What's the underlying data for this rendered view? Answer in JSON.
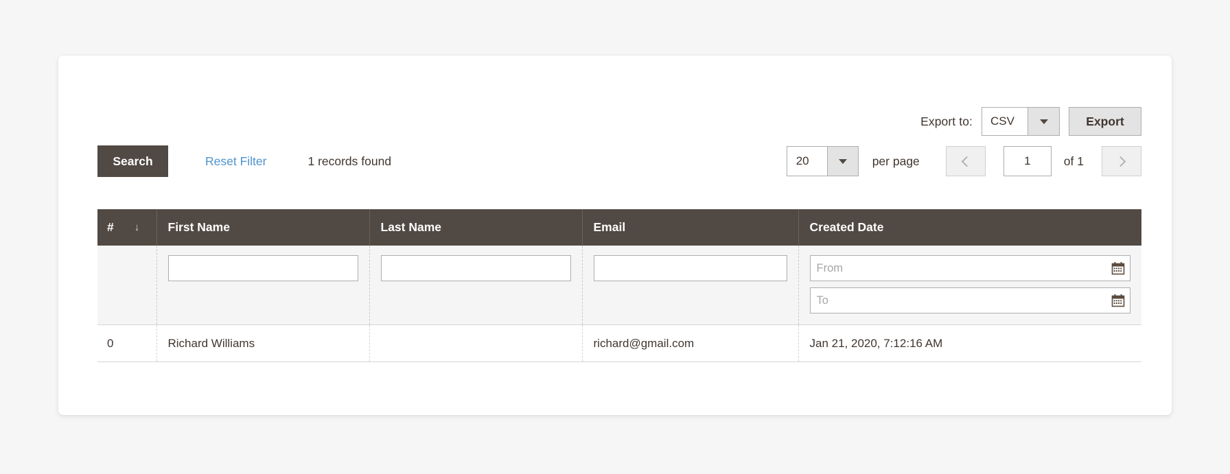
{
  "toolbar": {
    "export_to_label": "Export to:",
    "export_format": "CSV",
    "export_button_label": "Export"
  },
  "search_bar": {
    "search_button_label": "Search",
    "reset_filter_label": "Reset Filter",
    "records_found": "1 records found",
    "per_page_value": "20",
    "per_page_label": "per page",
    "current_page": "1",
    "of_pages": "of 1"
  },
  "table": {
    "columns": [
      {
        "label": "#",
        "sort_indicator": "↓"
      },
      {
        "label": "First Name"
      },
      {
        "label": "Last Name"
      },
      {
        "label": "Email"
      },
      {
        "label": "Created Date"
      }
    ],
    "filters": {
      "first_name": "",
      "last_name": "",
      "email": "",
      "date_from_placeholder": "From",
      "date_to_placeholder": "To",
      "date_from": "",
      "date_to": ""
    },
    "rows": [
      {
        "index": "0",
        "first_name": "Richard Williams",
        "last_name": "",
        "email": "richard@gmail.com",
        "created_date": "Jan 21, 2020, 7:12:16 AM"
      }
    ]
  },
  "colors": {
    "header_dark": "#514943",
    "link_blue": "#4d93cc",
    "page_background": "#f6f6f6",
    "filter_row_background": "#f5f5f5",
    "text": "#41362f"
  }
}
